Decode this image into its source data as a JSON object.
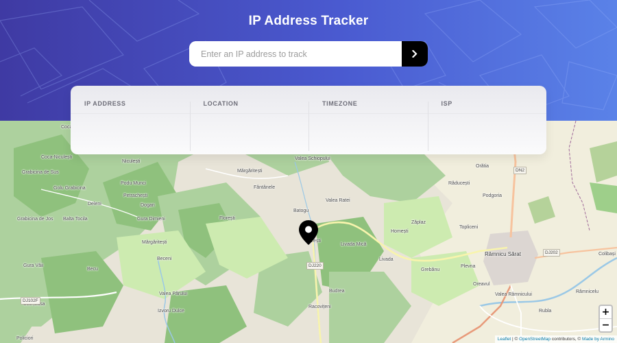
{
  "header": {
    "title": "IP Address Tracker"
  },
  "search": {
    "placeholder": "Enter an IP address to track",
    "value": "",
    "button_icon": "chevron-right-icon"
  },
  "info": {
    "ip_label": "IP ADDRESS",
    "ip_value": "",
    "location_label": "LOCATION",
    "location_value": "",
    "timezone_label": "TIMEZONE",
    "timezone_value": "",
    "isp_label": "ISP",
    "isp_value": ""
  },
  "map": {
    "zoom_in": "+",
    "zoom_out": "−",
    "marker_icon": "location-pin-icon",
    "places": {
      "cocaniculesti": "Coca-Niculești",
      "coca": "Coca",
      "niculesti": "Niculești",
      "margaritesti": "Mărgăritești",
      "valeaschiopului": "Valea Schiopului",
      "grabicinadesus": "Grabicina de Sus",
      "golugrabicina": "Golu Grabicina",
      "podumunci": "Podu Munci",
      "petrachesti": "Petrachești",
      "fantanele": "Fântânele",
      "valearatei": "Valea Ratei",
      "batogu": "Batogu",
      "dogari": "Dogari",
      "deleni": "Deleni",
      "baltatocila": "Balta Tocila",
      "guradimieni": "Gura Dimieni",
      "floresti": "Florești",
      "grabicinadejos": "Grabicina de Jos",
      "margaritesti2": "Mărgăritești",
      "bozesti": "Bozești",
      "livadamica": "Livada Mică",
      "livada": "Livada",
      "homesti": "Homești",
      "zaplaz": "Zăplaz",
      "oratia": "Orătia",
      "raducesti": "Răducești",
      "podgoria": "Podgoria",
      "topliceni": "Topliceni",
      "ramnicusarat": "Râmnicu Sărat",
      "guravaii": "Gura Văii",
      "becu": "Becu",
      "beceni": "Beceni",
      "grebanu": "Grebănu",
      "plevna": "Plevna",
      "oreavul": "Oreavul",
      "valearamnicului": "Valea Râmnicului",
      "colibasi": "Colibași",
      "ramnicelu": "Râmnicelu",
      "rubla": "Rubla",
      "valeaparului": "Valea Pârului",
      "budrea": "Budrea",
      "racoviteni": "Racovițeni",
      "scortoasa": "Scorțoasa",
      "izvoruldulce": "Izvoru Dulce",
      "policiori": "Policiori"
    },
    "roads": {
      "dn2": "DN2",
      "dj220": "DJ220",
      "dj202": "DJ202",
      "dj102f": "DJ102F"
    },
    "attribution": {
      "leaflet": "Leaflet",
      "sep1": " | © ",
      "osm": "OpenStreetMap",
      "contrib": " contributors, © ",
      "made_by": "Made by Armino"
    }
  }
}
